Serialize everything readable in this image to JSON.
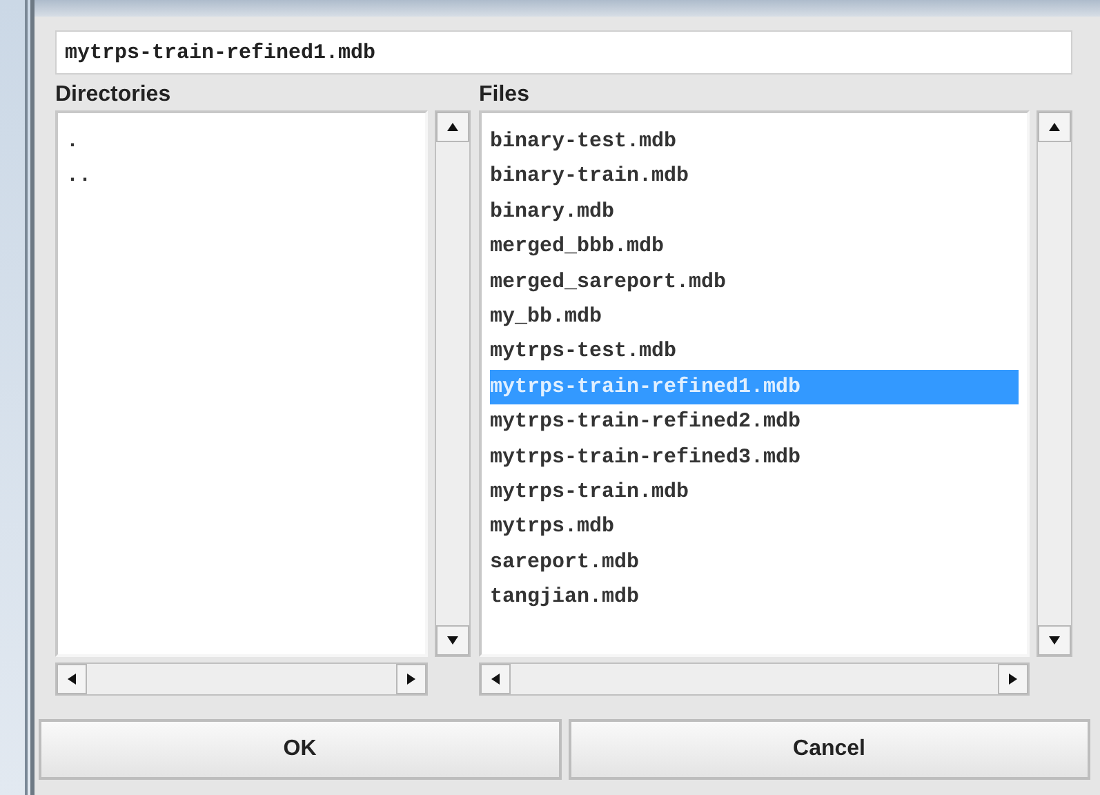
{
  "filename_field": {
    "value": "mytrps-train-refined1.mdb"
  },
  "directories": {
    "label": "Directories",
    "items": [
      {
        "name": ".",
        "selected": false
      },
      {
        "name": "..",
        "selected": false
      }
    ]
  },
  "files": {
    "label": "Files",
    "items": [
      {
        "name": "binary-test.mdb",
        "selected": false
      },
      {
        "name": "binary-train.mdb",
        "selected": false
      },
      {
        "name": "binary.mdb",
        "selected": false
      },
      {
        "name": "merged_bbb.mdb",
        "selected": false
      },
      {
        "name": "merged_sareport.mdb",
        "selected": false
      },
      {
        "name": "my_bb.mdb",
        "selected": false
      },
      {
        "name": "mytrps-test.mdb",
        "selected": false
      },
      {
        "name": "mytrps-train-refined1.mdb",
        "selected": true
      },
      {
        "name": "mytrps-train-refined2.mdb",
        "selected": false
      },
      {
        "name": "mytrps-train-refined3.mdb",
        "selected": false
      },
      {
        "name": "mytrps-train.mdb",
        "selected": false
      },
      {
        "name": "mytrps.mdb",
        "selected": false
      },
      {
        "name": "sareport.mdb",
        "selected": false
      },
      {
        "name": "tangjian.mdb",
        "selected": false
      }
    ]
  },
  "buttons": [
    "OK",
    "Cancel"
  ]
}
